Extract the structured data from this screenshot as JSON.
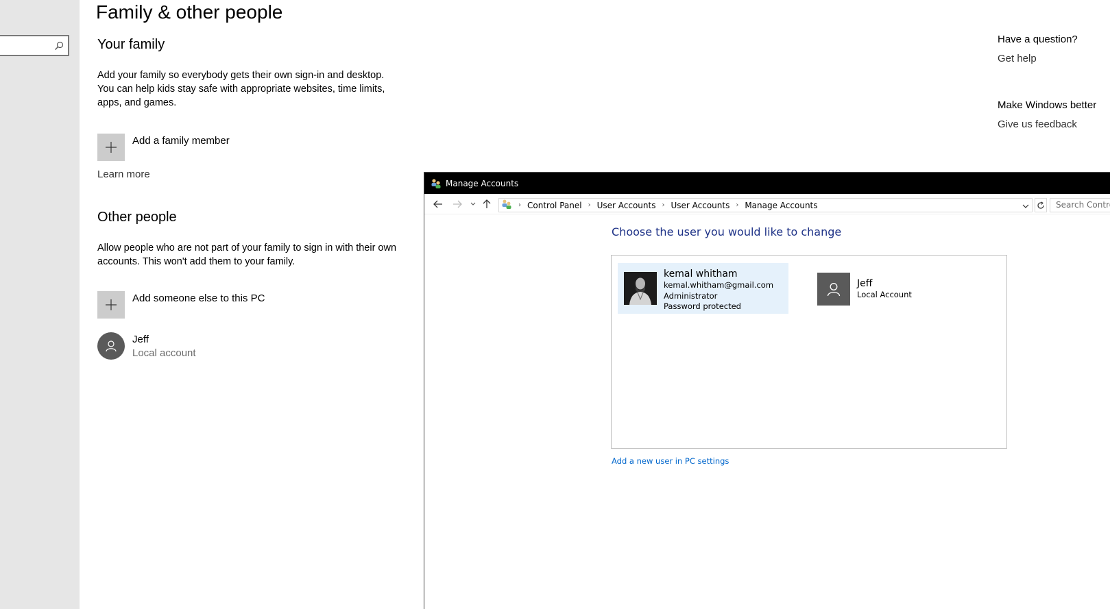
{
  "settings": {
    "page_title": "Family & other people",
    "your_family": {
      "heading": "Your family",
      "description": "Add your family so everybody gets their own sign-in and desktop. You can help kids stay safe with appropriate websites, time limits, apps, and games.",
      "add_label": "Add a family member",
      "learn_more": "Learn more"
    },
    "other_people": {
      "heading": "Other people",
      "description": "Allow people who are not part of your family to sign in with their own accounts. This won't add them to your family.",
      "add_label": "Add someone else to this PC",
      "people": [
        {
          "name": "Jeff",
          "type": "Local account",
          "icon": "person-icon"
        }
      ]
    },
    "help": {
      "question_heading": "Have a question?",
      "get_help": "Get help",
      "feedback_heading": "Make Windows better",
      "give_feedback": "Give us feedback"
    },
    "nav_search_icon": "search-icon"
  },
  "manage_accounts": {
    "window_title": "Manage Accounts",
    "breadcrumbs": [
      "Control Panel",
      "User Accounts",
      "User Accounts",
      "Manage Accounts"
    ],
    "search_placeholder": "Search Control Panel",
    "choose_title": "Choose the user you would like to change",
    "users": [
      {
        "name": "kemal whitham",
        "email": "kemal.whitham@gmail.com",
        "role": "Administrator",
        "status": "Password protected",
        "selected": true
      },
      {
        "name": "Jeff",
        "role": "Local Account",
        "selected": false
      }
    ],
    "add_user_link": "Add a new user in PC settings"
  },
  "colors": {
    "link_blue": "#0066cc",
    "heading_blue": "#1e3287",
    "selection_bg": "#e5f1fb",
    "tile_gray": "#cccccc",
    "avatar_gray": "#5a5a5a"
  }
}
